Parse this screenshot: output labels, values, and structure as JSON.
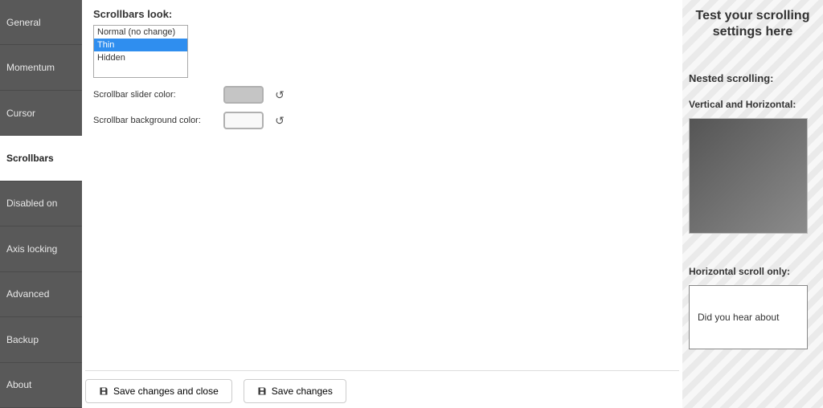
{
  "sidebar": {
    "items": [
      {
        "label": "General"
      },
      {
        "label": "Momentum"
      },
      {
        "label": "Cursor"
      },
      {
        "label": "Scrollbars"
      },
      {
        "label": "Disabled on"
      },
      {
        "label": "Axis locking"
      },
      {
        "label": "Advanced"
      },
      {
        "label": "Backup"
      },
      {
        "label": "About"
      }
    ],
    "active_index": 3
  },
  "main": {
    "section_title": "Scrollbars look:",
    "options": [
      {
        "label": "Normal (no change)"
      },
      {
        "label": "Thin"
      },
      {
        "label": "Hidden"
      }
    ],
    "selected_index": 1,
    "slider_color_label": "Scrollbar slider color:",
    "bg_color_label": "Scrollbar background color:",
    "slider_color": "#c5c5c5",
    "bg_color": "#f8f8f8"
  },
  "footer": {
    "save_close_label": "Save changes and close",
    "save_label": "Save changes"
  },
  "test": {
    "title": "Test your scrolling settings here",
    "nested_title": "Nested scrolling:",
    "vh_label": "Vertical and Horizontal:",
    "h_label": "Horizontal scroll only:",
    "h_text": "Did you hear about"
  }
}
